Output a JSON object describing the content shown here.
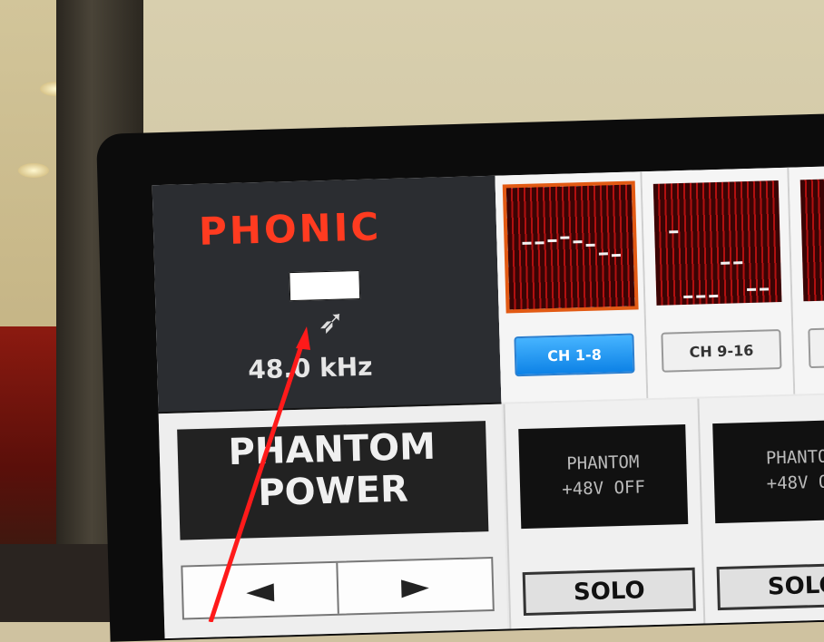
{
  "mixer": {
    "brand": "PHONIC",
    "sample_rate": "48.0 kHz",
    "channel_groups": [
      {
        "label": "CH 1-8",
        "selected": true
      },
      {
        "label": "CH 9-16",
        "selected": false
      },
      {
        "label": "C",
        "selected": false
      }
    ],
    "phantom_panel": {
      "title_line1": "PHANTOM",
      "title_line2": "POWER",
      "prev_label": "◄",
      "next_label": "►"
    },
    "strips": [
      {
        "phantom_line1": "PHANTOM",
        "phantom_line2": "+48V OFF",
        "solo_label": "SOLO"
      },
      {
        "phantom_line1": "PHANTO",
        "phantom_line2": "+48V O",
        "solo_label": "SOLO"
      }
    ]
  },
  "annotation": {
    "arrow_color": "#ff1a1a",
    "redaction_color": "#ffffff"
  },
  "colors": {
    "brand_red": "#ff3b20",
    "selected_blue": "#1a8cf0",
    "meter_red": "#b21010"
  }
}
